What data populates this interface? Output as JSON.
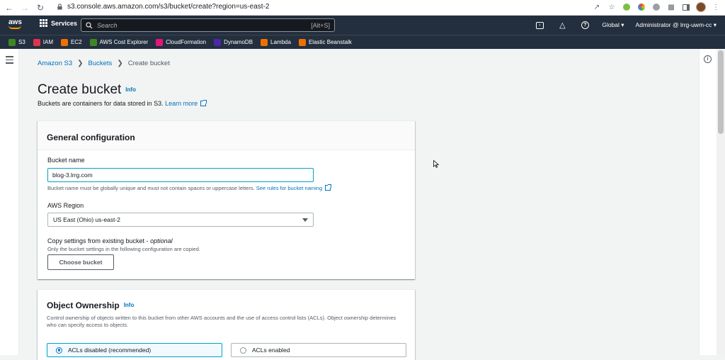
{
  "browser": {
    "url_text": "s3.console.aws.amazon.com/s3/bucket/create?region=us-east-2"
  },
  "topnav": {
    "logo": "aws",
    "services_label": "Services",
    "search_placeholder": "Search",
    "search_shortcut": "[Alt+S]",
    "region_label": "Global",
    "account_label": "Administrator @ lrrg-uwm-cc"
  },
  "favorites": [
    {
      "label": "S3",
      "color": "#3f8624"
    },
    {
      "label": "IAM",
      "color": "#dd344c"
    },
    {
      "label": "EC2",
      "color": "#ed7100"
    },
    {
      "label": "AWS Cost Explorer",
      "color": "#3f8624"
    },
    {
      "label": "CloudFormation",
      "color": "#e7157b"
    },
    {
      "label": "DynamoDB",
      "color": "#4d27aa"
    },
    {
      "label": "Lambda",
      "color": "#ed7100"
    },
    {
      "label": "Elastic Beanstalk",
      "color": "#ed7100"
    }
  ],
  "breadcrumb": {
    "items": [
      "Amazon S3",
      "Buckets"
    ],
    "current": "Create bucket"
  },
  "page": {
    "title": "Create bucket",
    "info": "Info",
    "description": "Buckets are containers for data stored in S3.",
    "learn_more": "Learn more"
  },
  "general": {
    "title": "General configuration",
    "bucket_name_label": "Bucket name",
    "bucket_name_value": "blog-3.lrrg.com",
    "bucket_name_hint": "Bucket name must be globally unique and must not contain spaces or uppercase letters.",
    "bucket_name_hint_link": "See rules for bucket naming",
    "region_label": "AWS Region",
    "region_value": "US East (Ohio) us-east-2",
    "copy_label": "Copy settings from existing bucket - ",
    "copy_optional": "optional",
    "copy_hint": "Only the bucket settings in the following configuration are copied.",
    "choose_button": "Choose bucket"
  },
  "ownership": {
    "title": "Object Ownership",
    "info": "Info",
    "description": "Control ownership of objects written to this bucket from other AWS accounts and the use of access control lists (ACLs). Object ownership determines who can specify access to objects.",
    "option_disabled": "ACLs disabled (recommended)",
    "option_enabled": "ACLs enabled"
  }
}
